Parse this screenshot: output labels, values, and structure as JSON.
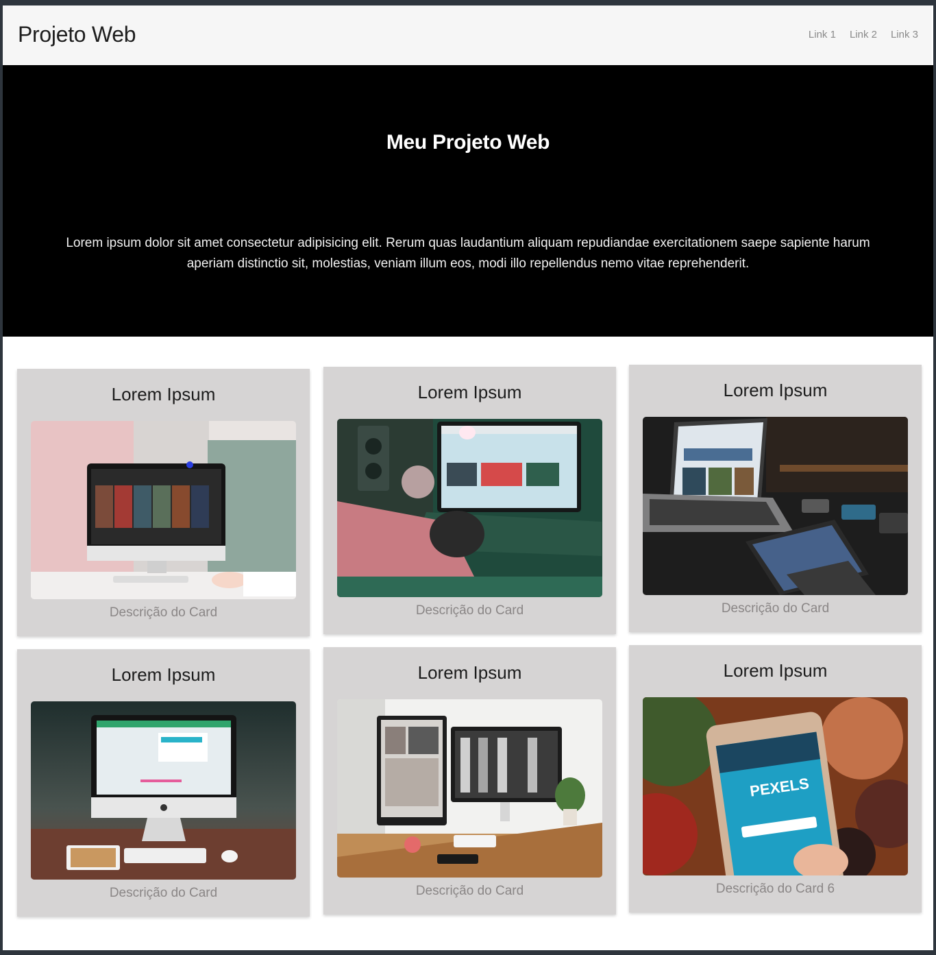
{
  "navbar": {
    "brand": "Projeto Web",
    "links": [
      "Link 1",
      "Link 2",
      "Link 3"
    ]
  },
  "hero": {
    "title": "Meu Projeto Web",
    "text": "Lorem ipsum dolor sit amet consectetur adipisicing elit. Rerum quas laudantium aliquam repudiandae exercitationem saepe sapiente harum aperiam distinctio sit, molestias, veniam illum eos, modi illo repellendus nemo vitae reprehenderit."
  },
  "cards": [
    {
      "title": "Lorem Ipsum",
      "description": "Descrição do Card",
      "image": "desktop-monitor-streaming-photo"
    },
    {
      "title": "Lorem Ipsum",
      "description": "Descrição do Card",
      "image": "laptop-desk-green-light-photo"
    },
    {
      "title": "Lorem Ipsum",
      "description": "Descrição do Card",
      "image": "laptop-and-tablets-dark-photo"
    },
    {
      "title": "Lorem Ipsum",
      "description": "Descrição do Card",
      "image": "imac-on-wood-desk-photo"
    },
    {
      "title": "Lorem Ipsum",
      "description": "Descrição do Card",
      "image": "dual-monitor-workspace-photo"
    },
    {
      "title": "Lorem Ipsum",
      "description": "Descrição do Card 6",
      "image": "phone-pexels-app-photo",
      "image_text": "PEXELS"
    }
  ],
  "colors": {
    "navbar_bg": "#f6f6f6",
    "hero_bg": "#000000",
    "card_bg": "#d6d4d4",
    "description_text": "#8a8686"
  }
}
